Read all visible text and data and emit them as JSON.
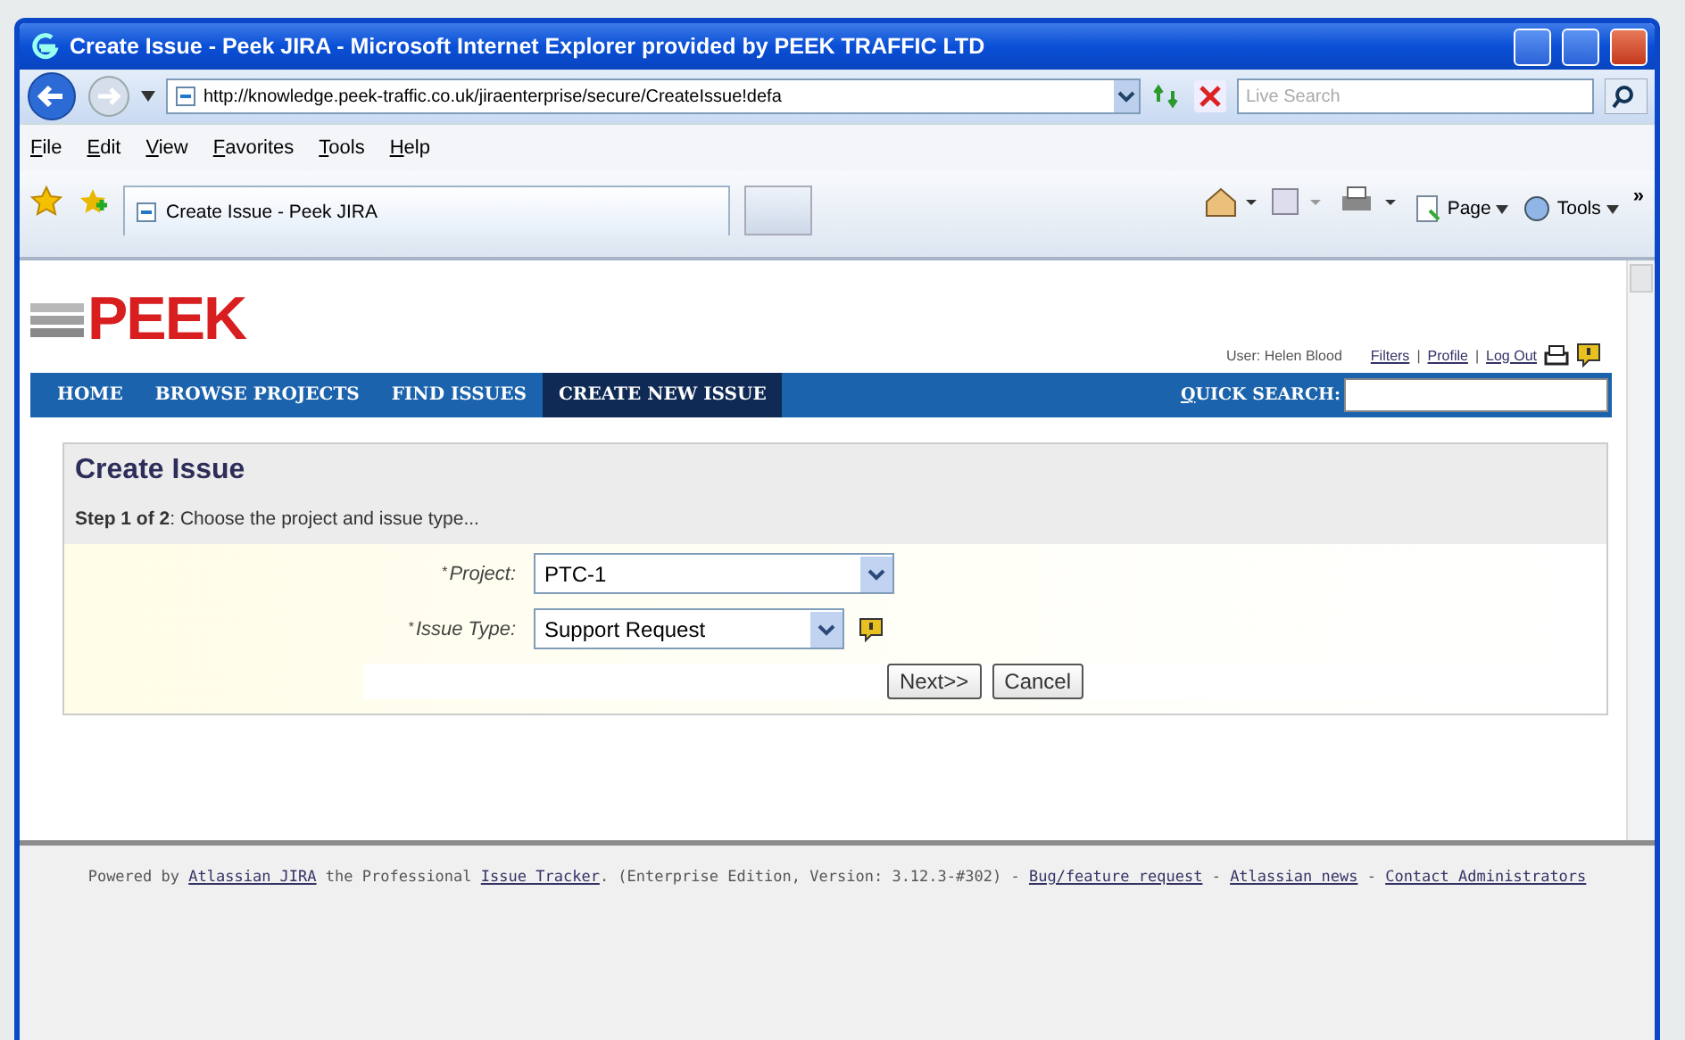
{
  "window": {
    "title": "Create Issue - Peek JIRA - Microsoft Internet Explorer provided by PEEK TRAFFIC LTD"
  },
  "address_bar": {
    "url": "http://knowledge.peek-traffic.co.uk/jiraenterprise/secure/CreateIssue!defa"
  },
  "search": {
    "placeholder": "Live Search"
  },
  "menu": [
    "File",
    "Edit",
    "View",
    "Favorites",
    "Tools",
    "Help"
  ],
  "tabs": [
    {
      "label": "Create Issue - Peek JIRA",
      "selected": true
    }
  ],
  "command_bar": {
    "items": [
      "Page",
      "Tools"
    ],
    "more": "»"
  },
  "site": {
    "logo": "PEEK",
    "user": "User: Helen Blood",
    "user_links": [
      {
        "kind": "link",
        "text": "Filters"
      },
      {
        "kind": "separator",
        "text": "|"
      },
      {
        "kind": "link",
        "text": "Profile"
      },
      {
        "kind": "separator",
        "text": "|"
      },
      {
        "kind": "link",
        "text": "Log Out"
      }
    ]
  },
  "nav": [
    {
      "label": "HOME",
      "selected": false
    },
    {
      "label": "BROWSE PROJECTS",
      "selected": false
    },
    {
      "label": "FIND ISSUES",
      "selected": false
    },
    {
      "label": "CREATE NEW ISSUE",
      "selected": true
    }
  ],
  "quick_search": {
    "label": "QUICK SEARCH:"
  },
  "form": {
    "title": "Create Issue",
    "step": "**Step 1 of 2**: Choose the project and issue type...",
    "fields": [
      {
        "mark": "*",
        "label": "Project:",
        "value": "PTC-1",
        "help": false
      },
      {
        "mark": "*",
        "label": "Issue Type:",
        "value": "Support Request",
        "help": true
      }
    ],
    "buttons": [
      "Next>>",
      "Cancel"
    ]
  },
  "footer": [
    {
      "text": "Powered by ",
      "link": false
    },
    {
      "text": "Atlassian JIRA",
      "link": true
    },
    {
      "text": " the Professional ",
      "link": false
    },
    {
      "text": "Issue Tracker",
      "link": true
    },
    {
      "text": ". (Enterprise Edition, Version: 3.12.3-#302) - ",
      "link": false
    },
    {
      "text": "Bug/feature request",
      "link": true
    },
    {
      "text": " - ",
      "link": false
    },
    {
      "text": "Atlassian news",
      "link": true
    },
    {
      "text": " - ",
      "link": false
    },
    {
      "text": "Contact Administrators",
      "link": true
    }
  ]
}
